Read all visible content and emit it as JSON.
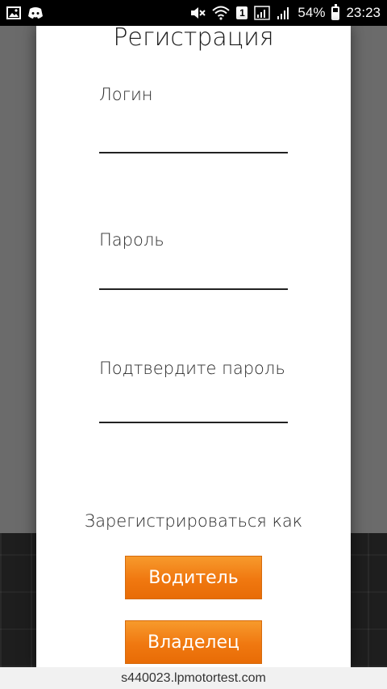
{
  "status_bar": {
    "sim_number": "1",
    "battery": "54%",
    "battery_level": 0.54,
    "time": "23:23",
    "icons": [
      "image-icon",
      "discord-icon",
      "mute-icon",
      "wifi-icon",
      "signal-icon",
      "signal-icon",
      "battery-icon"
    ]
  },
  "modal": {
    "title": "Регистрация",
    "fields": [
      {
        "label": "Логин",
        "value": ""
      },
      {
        "label": "Пароль",
        "value": ""
      },
      {
        "label": "Подтвердите пароль",
        "value": ""
      }
    ],
    "register_as_label": "Зарегистрироваться как",
    "buttons": {
      "driver": "Водитель",
      "owner": "Владелец"
    }
  },
  "browser": {
    "url": "s440023.lpmotortest.com"
  },
  "colors": {
    "accent_orange": "#f07810",
    "backdrop": "#6b6b6b",
    "modal_bg": "#ffffff"
  }
}
